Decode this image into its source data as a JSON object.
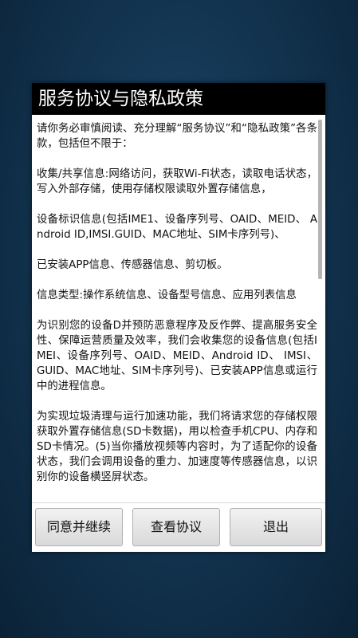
{
  "dialog": {
    "title": "服务协议与隐私政策",
    "paragraphs": [
      "请你务必审慎阅读、充分理解“服务协议”和“隐私政策”各条款，包括但不限于：",
      "收集/共享信息:网络访问，获取Wi-Fi状态，读取电话状态，写入外部存储，使用存储权限读取外置存储信息，",
      "设备标识信息(包括IME1、设备序列号、OAID、MEID、 Android ID,IMSI.GUID、MAC地址、SIM卡序列号)、",
      "已安装APP信息、传感器信息、剪切板。",
      "信息类型:操作系统信息、设备型号信息、应用列表信息",
      "为识别您的设备D并预防恶意程序及反作弊、提高服务安全性、保障运营质量及效率，我们会收集您的设备信息(包括IMEI、设备序列号、OAID、MEID、Android ID、 IMSI、GUID、MAC地址、SIM卡序列号)、已安装APP信息或运行中的进程信息。",
      "为实现垃圾清理与运行加速功能，我们将请求您的存储权限获取外置存储信息(SD卡数据)，用以检查手机CPU、内存和SD卡情况。(5)当你播放视频等内容时，为了适配你的设备状态，我们会调用设备的重力、加速度等传感器信息，以识别你的设备横竖屏状态。"
    ],
    "buttons": {
      "agree": "同意并继续",
      "view": "查看协议",
      "exit": "退出"
    }
  }
}
